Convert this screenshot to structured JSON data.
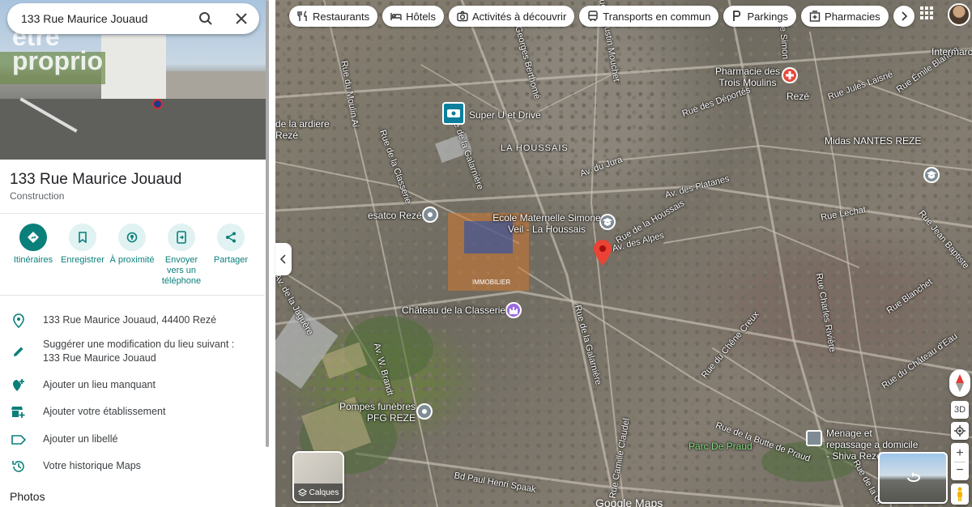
{
  "search": {
    "value": "133 Rue Maurice Jouaud",
    "search_icon": "search-icon",
    "close_icon": "close-icon"
  },
  "photo": {
    "watermark": "être proprio"
  },
  "place": {
    "title": "133 Rue Maurice Jouaud",
    "category": "Construction"
  },
  "actions": [
    {
      "label": "Itinéraires",
      "icon": "directions-icon"
    },
    {
      "label": "Enregistrer",
      "icon": "bookmark-icon"
    },
    {
      "label": "À proximité",
      "icon": "nearby-icon"
    },
    {
      "label": "Envoyer vers un téléphone",
      "icon": "send-to-phone-icon"
    },
    {
      "label": "Partager",
      "icon": "share-icon"
    }
  ],
  "info": [
    {
      "text": "133 Rue Maurice Jouaud, 44400 Rezé",
      "icon": "location-pin-icon"
    },
    {
      "text": "Suggérer une modification du lieu suivant : 133 Rue Maurice Jouaud",
      "icon": "edit-pencil-icon"
    },
    {
      "text": "Ajouter un lieu manquant",
      "icon": "add-place-icon"
    },
    {
      "text": "Ajouter votre établissement",
      "icon": "add-business-icon"
    },
    {
      "text": "Ajouter un libellé",
      "icon": "label-icon"
    },
    {
      "text": "Votre historique Maps",
      "icon": "history-icon"
    }
  ],
  "photos_heading": "Photos",
  "chips": [
    {
      "label": "Restaurants",
      "icon": "restaurant-icon"
    },
    {
      "label": "Hôtels",
      "icon": "hotel-icon"
    },
    {
      "label": "Activités à découvrir",
      "icon": "camera-icon"
    },
    {
      "label": "Transports en commun",
      "icon": "transit-icon"
    },
    {
      "label": "Parkings",
      "icon": "parking-icon"
    },
    {
      "label": "Pharmacies",
      "icon": "pharmacy-icon"
    }
  ],
  "map": {
    "poi": {
      "supermarket": "Super U et Drive",
      "school": "Ecole Maternelle Simone Veil - La Houssais",
      "pharmacy": "Pharmacie des Trois Moulins",
      "midas": "Midas NANTES REZE",
      "esatco": "esatco Rezé",
      "chateau": "Château de la Classerie",
      "pompes": "Pompes funèbres PFG REZE",
      "park": "Parc De Praud",
      "menage": "Menage et repassage a domicile - Shiva Rezé",
      "intermarche": "Intermarc",
      "commune": "Rezé",
      "district": "LA HOUSSAIS",
      "board": "de la ardiere Rezé"
    },
    "streets": [
      "Rue de la Classerie",
      "Rue de la Galarnière",
      "Rue de la Galarnière",
      "Rue Georges Berthomé",
      "Rue Augustin Mouchet",
      "Rue Simon",
      "Rue du Moulin Ai",
      "Rue de la Houssais",
      "Av. du Jura",
      "Av. des Alpes",
      "Av. des Platanes",
      "Rue Lechat",
      "Rue Charles Rivière",
      "Rue du Chêne Creux",
      "Rue de la Butte de Praud",
      "Rue Camille Claudel",
      "Bd Paul Henri Spaak",
      "Rue de la Gr",
      "Av. W. Brandt",
      "Rue des Déportés",
      "Rue Jules Laisné",
      "Rue Émile Blandin",
      "Rue Blanchet",
      "Rue du Château d'Eau",
      "Rue Jean Baptiste",
      "Av. de la Jaguère"
    ],
    "layers_label": "Calques",
    "google": "Google Maps",
    "controls": {
      "three_d": "3D"
    },
    "agency_banner": "IMMOBILIER"
  }
}
